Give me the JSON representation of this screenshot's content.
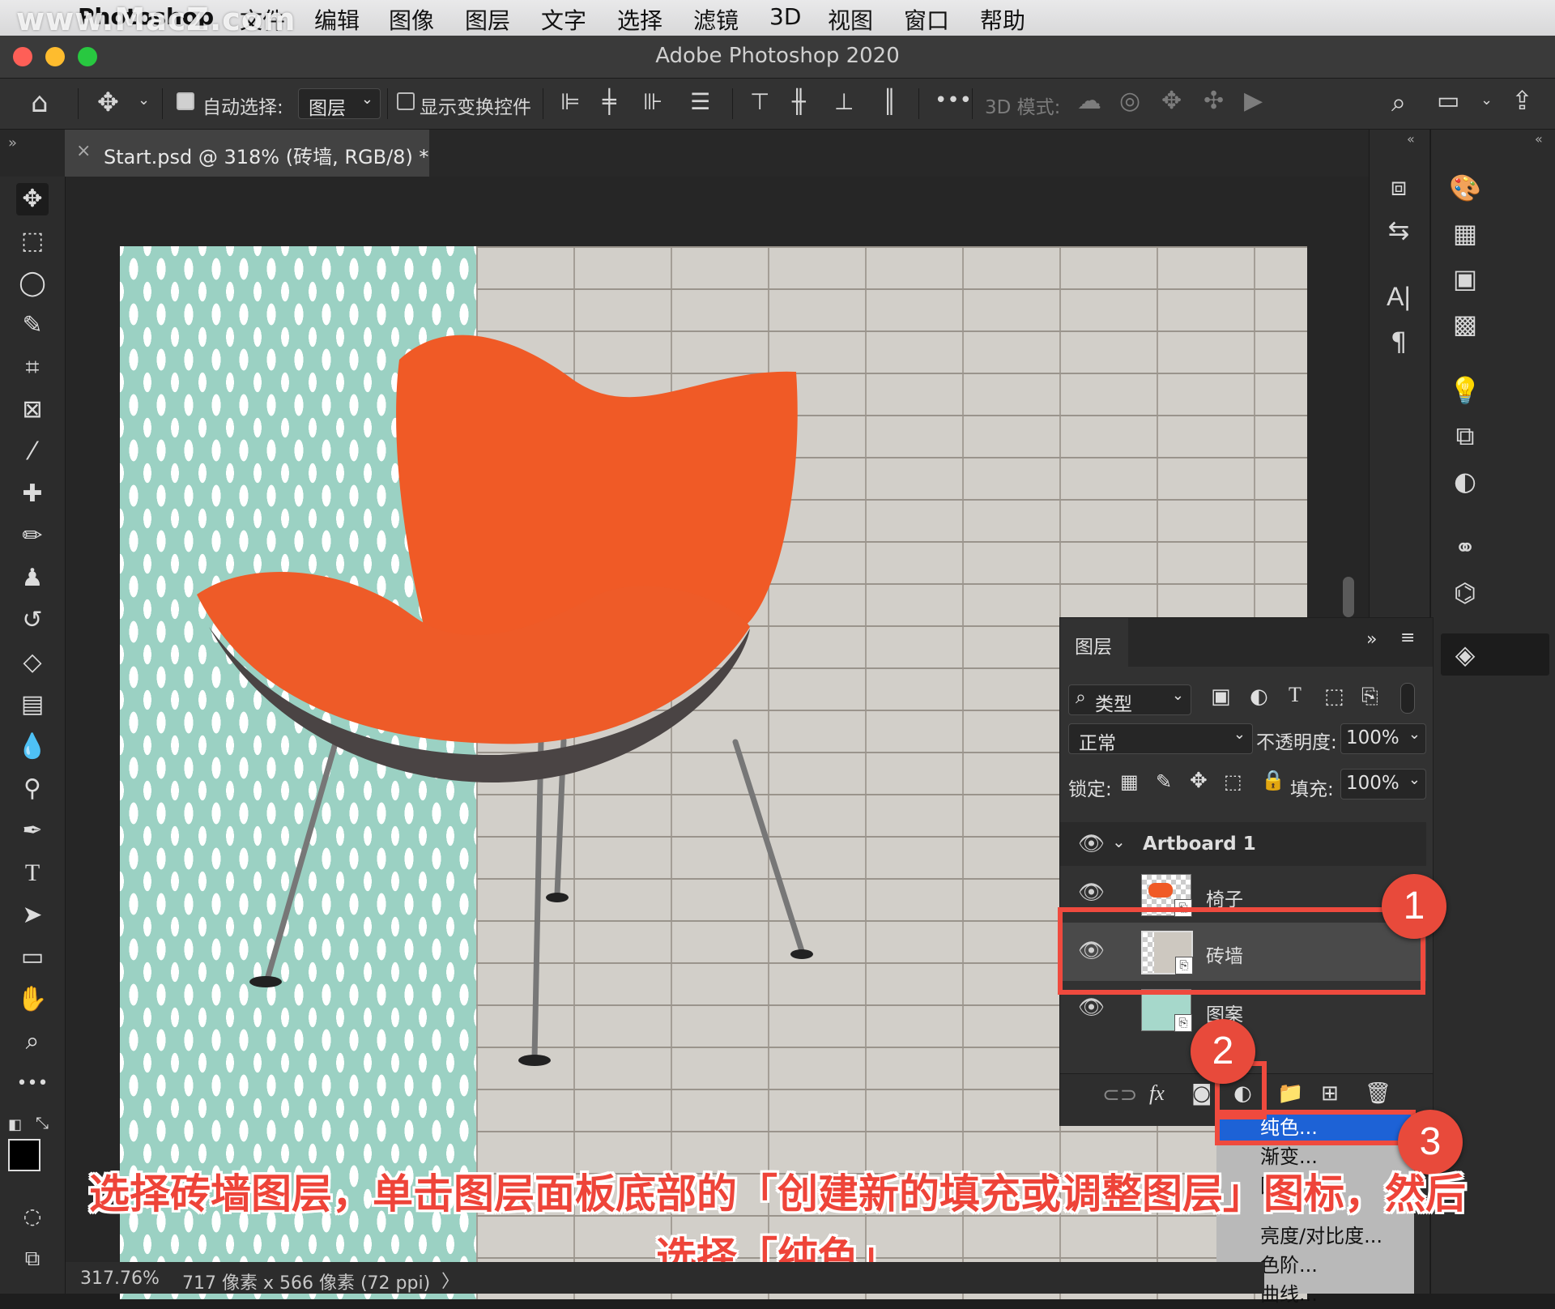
{
  "menubar": {
    "watermark": "www.MacZ.com",
    "app_name": "Photoshop",
    "items": [
      "文件",
      "编辑",
      "图像",
      "图层",
      "文字",
      "选择",
      "滤镜",
      "3D",
      "视图",
      "窗口",
      "帮助"
    ]
  },
  "window": {
    "title": "Adobe Photoshop 2020"
  },
  "options_bar": {
    "auto_select_label": "自动选择:",
    "auto_select_target": "图层",
    "show_transform_label": "显示变换控件",
    "three_d_mode_label": "3D 模式:",
    "more": "•••"
  },
  "document_tab": {
    "close": "×",
    "title": "Start.psd @ 318% (砖墙, RGB/8) *"
  },
  "layers_panel": {
    "title": "图层",
    "filter_label": "类型",
    "blend_mode": "正常",
    "opacity_label": "不透明度:",
    "opacity_value": "100%",
    "lock_label": "锁定:",
    "fill_label": "填充:",
    "fill_value": "100%",
    "artboard_name": "Artboard 1",
    "layers": [
      {
        "name": "椅子",
        "selected": false
      },
      {
        "name": "砖墙",
        "selected": true
      },
      {
        "name": "图案",
        "selected": false
      }
    ],
    "fx_label": "fx"
  },
  "adjustment_menu": {
    "items": [
      "纯色...",
      "渐变...",
      "图案...",
      "",
      "亮度/对比度...",
      "色阶...",
      "曲线..."
    ],
    "highlighted_index": 0
  },
  "callouts": [
    "1",
    "2",
    "3"
  ],
  "caption": {
    "line1": "选择砖墙图层，单击图层面板底部的「创建新的填充或调整图层」图标，然后",
    "line2": "选择「纯色」"
  },
  "status_bar": {
    "zoom": "317.76%",
    "doc_info": "717 像素 x 566 像素 (72 ppi)",
    "arrow": "〉"
  },
  "colors": {
    "accent_red": "#e84a3b",
    "chair_orange": "#f05a26",
    "menu_highlight": "#1d62d6",
    "pattern_teal": "#9bd1c3"
  }
}
